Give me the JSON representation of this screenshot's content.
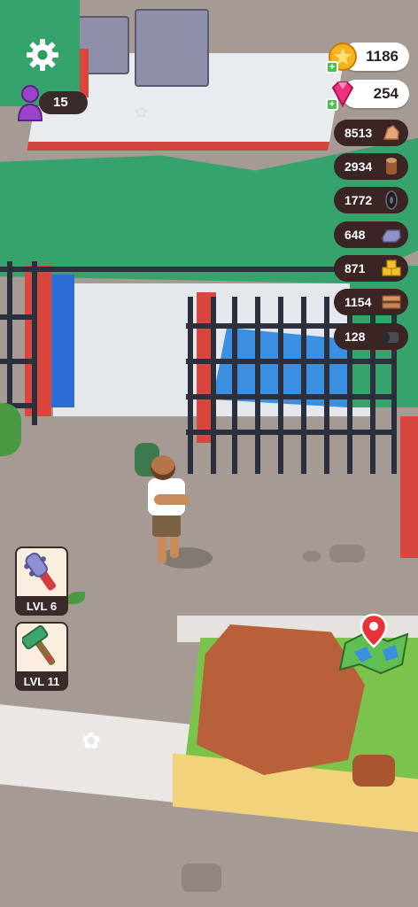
{
  "hud": {
    "players": {
      "count": "15",
      "icon": "person-icon"
    },
    "currencies": [
      {
        "name": "coins",
        "value": "1186",
        "icon": "coin-icon"
      },
      {
        "name": "gems",
        "value": "254",
        "icon": "gem-icon"
      }
    ],
    "resources": [
      {
        "value": "8513",
        "icon": "stone-chunk-icon"
      },
      {
        "value": "2934",
        "icon": "wood-log-icon"
      },
      {
        "value": "1772",
        "icon": "rubber-tire-icon"
      },
      {
        "value": "648",
        "icon": "metal-ingot-icon"
      },
      {
        "value": "871",
        "icon": "gold-bars-icon"
      },
      {
        "value": "1154",
        "icon": "wood-planks-icon"
      },
      {
        "value": "128",
        "icon": "cloth-roll-icon"
      }
    ],
    "tools": [
      {
        "level": "LVL 6",
        "icon": "spiked-club-icon"
      },
      {
        "level": "LVL 11",
        "icon": "hammer-icon"
      }
    ],
    "map": {
      "icon": "map-location-icon"
    }
  },
  "colors": {
    "roof": "#35a36b",
    "wall": "#d8463e",
    "pill_dark": "#3a2424",
    "plus": "#4cc04c",
    "gem": "#f0307a",
    "coin": "#f5b31f"
  }
}
